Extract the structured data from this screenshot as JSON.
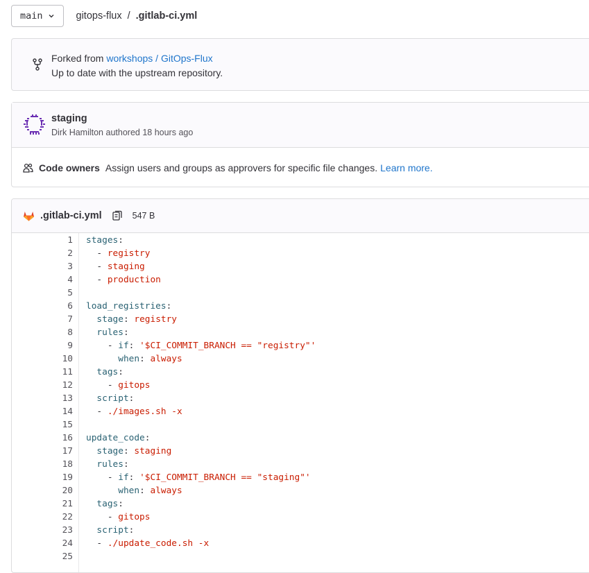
{
  "topbar": {
    "branch": "main",
    "project": "gitops-flux",
    "separator": "/",
    "file": ".gitlab-ci.yml"
  },
  "fork": {
    "prefix": "Forked from",
    "upstream_link": "workshops / GitOps-Flux",
    "status": "Up to date with the upstream repository."
  },
  "commit": {
    "title": "staging",
    "author": "Dirk Hamilton",
    "meta_suffix": "authored 18 hours ago"
  },
  "owners": {
    "label": "Code owners",
    "description": "Assign users and groups as approvers for specific file changes.",
    "learn_more": "Learn more."
  },
  "file": {
    "name": ".gitlab-ci.yml",
    "size": "547 B"
  },
  "code": [
    {
      "n": "1",
      "parts": [
        [
          "k",
          "stages"
        ],
        [
          "p",
          ":"
        ]
      ]
    },
    {
      "n": "2",
      "parts": [
        [
          "p",
          "  - "
        ],
        [
          "v",
          "registry"
        ]
      ]
    },
    {
      "n": "3",
      "parts": [
        [
          "p",
          "  - "
        ],
        [
          "v",
          "staging"
        ]
      ]
    },
    {
      "n": "4",
      "parts": [
        [
          "p",
          "  - "
        ],
        [
          "v",
          "production"
        ]
      ]
    },
    {
      "n": "5",
      "parts": []
    },
    {
      "n": "6",
      "parts": [
        [
          "k",
          "load_registries"
        ],
        [
          "p",
          ":"
        ]
      ]
    },
    {
      "n": "7",
      "parts": [
        [
          "p",
          "  "
        ],
        [
          "k",
          "stage"
        ],
        [
          "p",
          ": "
        ],
        [
          "v",
          "registry"
        ]
      ]
    },
    {
      "n": "8",
      "parts": [
        [
          "p",
          "  "
        ],
        [
          "k",
          "rules"
        ],
        [
          "p",
          ":"
        ]
      ]
    },
    {
      "n": "9",
      "parts": [
        [
          "p",
          "    - "
        ],
        [
          "k",
          "if"
        ],
        [
          "p",
          ": "
        ],
        [
          "v",
          "'$CI_COMMIT_BRANCH == \"registry\"'"
        ]
      ]
    },
    {
      "n": "10",
      "parts": [
        [
          "p",
          "      "
        ],
        [
          "k",
          "when"
        ],
        [
          "p",
          ": "
        ],
        [
          "v",
          "always"
        ]
      ]
    },
    {
      "n": "11",
      "parts": [
        [
          "p",
          "  "
        ],
        [
          "k",
          "tags"
        ],
        [
          "p",
          ":"
        ]
      ]
    },
    {
      "n": "12",
      "parts": [
        [
          "p",
          "    - "
        ],
        [
          "v",
          "gitops"
        ]
      ]
    },
    {
      "n": "13",
      "parts": [
        [
          "p",
          "  "
        ],
        [
          "k",
          "script"
        ],
        [
          "p",
          ":"
        ]
      ]
    },
    {
      "n": "14",
      "parts": [
        [
          "p",
          "  - "
        ],
        [
          "v",
          "./images.sh -x"
        ]
      ]
    },
    {
      "n": "15",
      "parts": []
    },
    {
      "n": "16",
      "parts": [
        [
          "k",
          "update_code"
        ],
        [
          "p",
          ":"
        ]
      ]
    },
    {
      "n": "17",
      "parts": [
        [
          "p",
          "  "
        ],
        [
          "k",
          "stage"
        ],
        [
          "p",
          ": "
        ],
        [
          "v",
          "staging"
        ]
      ]
    },
    {
      "n": "18",
      "parts": [
        [
          "p",
          "  "
        ],
        [
          "k",
          "rules"
        ],
        [
          "p",
          ":"
        ]
      ]
    },
    {
      "n": "19",
      "parts": [
        [
          "p",
          "    - "
        ],
        [
          "k",
          "if"
        ],
        [
          "p",
          ": "
        ],
        [
          "v",
          "'$CI_COMMIT_BRANCH == \"staging\"'"
        ]
      ]
    },
    {
      "n": "20",
      "parts": [
        [
          "p",
          "      "
        ],
        [
          "k",
          "when"
        ],
        [
          "p",
          ": "
        ],
        [
          "v",
          "always"
        ]
      ]
    },
    {
      "n": "21",
      "parts": [
        [
          "p",
          "  "
        ],
        [
          "k",
          "tags"
        ],
        [
          "p",
          ":"
        ]
      ]
    },
    {
      "n": "22",
      "parts": [
        [
          "p",
          "    - "
        ],
        [
          "v",
          "gitops"
        ]
      ]
    },
    {
      "n": "23",
      "parts": [
        [
          "p",
          "  "
        ],
        [
          "k",
          "script"
        ],
        [
          "p",
          ":"
        ]
      ]
    },
    {
      "n": "24",
      "parts": [
        [
          "p",
          "  - "
        ],
        [
          "v",
          "./update_code.sh -x"
        ]
      ]
    },
    {
      "n": "25",
      "parts": []
    }
  ],
  "colors": {
    "link": "#1f75cb",
    "yaml_key": "#2a6273",
    "yaml_value": "#c91c00",
    "gitlab_orange": "#e24329",
    "avatar_purple": "#6b2fb3"
  }
}
